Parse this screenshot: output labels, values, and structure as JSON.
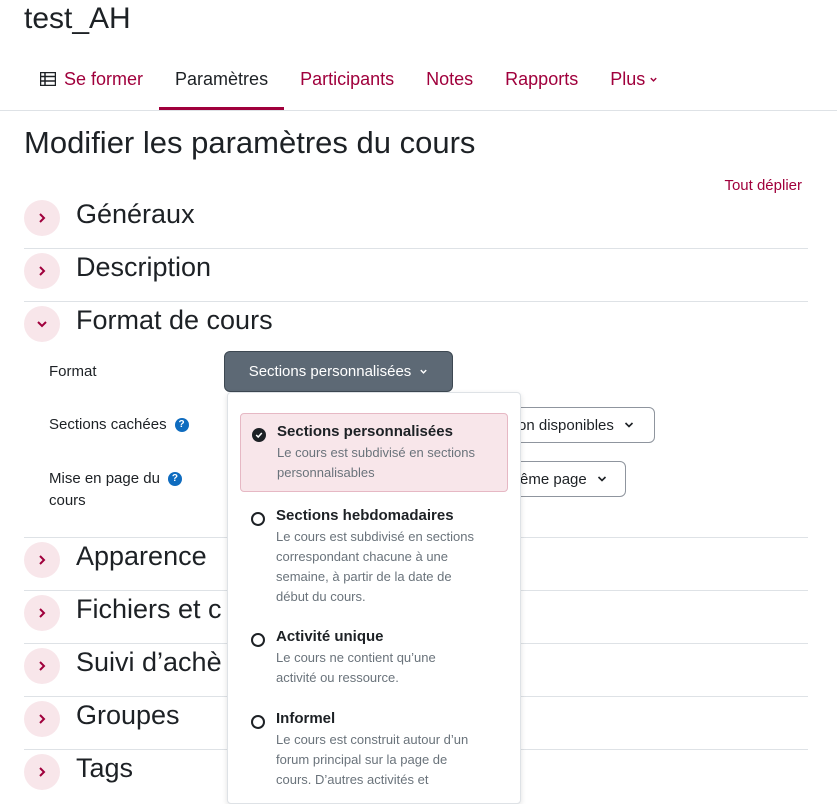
{
  "course": {
    "title": "test_AH"
  },
  "nav": {
    "items": [
      {
        "label": "Se former",
        "icon": "course-index-icon"
      },
      {
        "label": "Paramètres",
        "active": true
      },
      {
        "label": "Participants"
      },
      {
        "label": "Notes"
      },
      {
        "label": "Rapports"
      },
      {
        "label": "Plus"
      }
    ]
  },
  "page": {
    "title": "Modifier les paramètres du cours",
    "expand_all": "Tout déplier"
  },
  "sections": [
    {
      "label": "Généraux",
      "expanded": false
    },
    {
      "label": "Description",
      "expanded": false
    },
    {
      "label": "Format de cours",
      "expanded": true
    },
    {
      "label": "Apparence",
      "expanded": false
    },
    {
      "label": "Fichiers et c",
      "expanded": false
    },
    {
      "label": "Suivi d’achè",
      "expanded": false
    },
    {
      "label": "Groupes",
      "expanded": false
    },
    {
      "label": "Tags",
      "expanded": false
    }
  ],
  "format_fields": {
    "format_label": "Format",
    "format_value": "Sections personnalisées",
    "hidden_sections_label": "Sections cachées",
    "hidden_sections_value": "on disponibles",
    "layout_label_line1": "Mise en page du",
    "layout_label_line2": "cours",
    "layout_value": "ême page"
  },
  "format_options": [
    {
      "title": "Sections personnalisées",
      "desc_1": "Le cours est subdivisé en sections",
      "desc_2": "personnalisables",
      "selected": true
    },
    {
      "title": "Sections hebdomadaires",
      "desc_1": "Le cours est subdivisé en sections",
      "desc_2": "correspondant chacune à une",
      "desc_3": "semaine, à partir de la date de",
      "desc_4": "début du cours."
    },
    {
      "title": "Activité unique",
      "desc_1": "Le cours ne contient qu’une",
      "desc_2": "activité ou ressource."
    },
    {
      "title": "Informel",
      "desc_1": "Le cours est construit autour d’un",
      "desc_2": "forum principal sur la page de",
      "desc_3": "cours. D’autres activités et"
    }
  ],
  "colors": {
    "accent": "#a0003c",
    "select_bg": "#5d6975",
    "selected_option_bg": "#f8e6ea",
    "help": "#0f6cbf"
  }
}
